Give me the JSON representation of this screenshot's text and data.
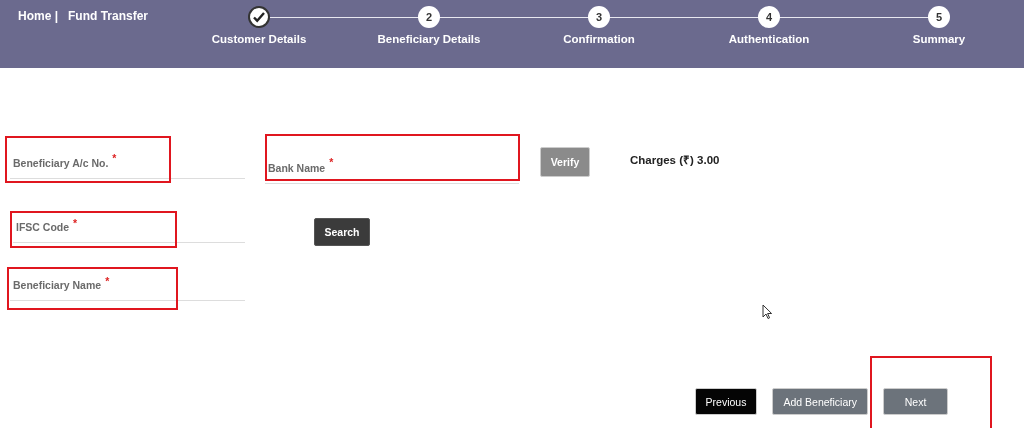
{
  "breadcrumb": {
    "home": "Home |",
    "current": "Fund Transfer"
  },
  "steps": [
    {
      "label": "Customer Details",
      "completed": true
    },
    {
      "label": "Beneficiary Details",
      "number": "2",
      "completed": false
    },
    {
      "label": "Confirmation",
      "number": "3",
      "completed": false
    },
    {
      "label": "Authentication",
      "number": "4",
      "completed": false
    },
    {
      "label": "Summary",
      "number": "5",
      "completed": false
    }
  ],
  "fields": {
    "account_no": {
      "label": "Beneficiary A/c No.",
      "required": "*",
      "highlighted": true
    },
    "bank_name": {
      "label": "Bank Name",
      "required": "*",
      "highlighted": true
    },
    "ifsc": {
      "label": "IFSC Code",
      "required": "*",
      "highlighted": true
    },
    "beneficiary_name": {
      "label": "Beneficiary Name",
      "required": "*",
      "highlighted": true
    }
  },
  "verify_button": "Verify",
  "charges": "Charges (₹) 3.00",
  "search_button": "Search",
  "buttons": [
    {
      "label": "Previous",
      "kind": "dark",
      "highlighted": false
    },
    {
      "label": "Add Beneficiary",
      "kind": "grey",
      "highlighted": false
    },
    {
      "label": "Next",
      "kind": "grey",
      "highlighted": true
    }
  ]
}
